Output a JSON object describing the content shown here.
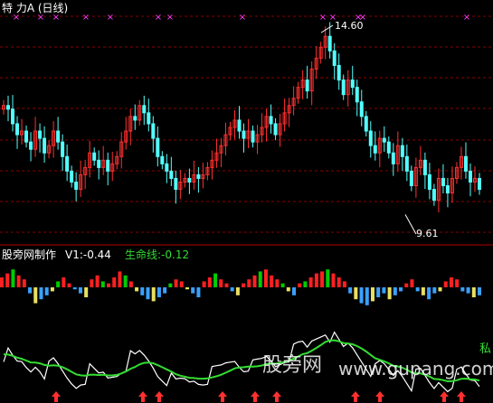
{
  "header": {
    "title": "特  力A (日线)"
  },
  "price_annotations": {
    "high_label": "14.60",
    "low_label": "9.61"
  },
  "indicator": {
    "name": "股旁网制作",
    "v1_label": "V1:-0.44",
    "life_label": "生命线:-0.12"
  },
  "watermark": {
    "site_cn": "股旁网",
    "site_en": "www.gupang.com",
    "corner_char": "私"
  },
  "colors": {
    "background": "#000000",
    "up_candle": "#ff3030",
    "down_candle": "#54ffff",
    "grid": "#8a0000",
    "marker": "#ff40ff",
    "hist_red": "#ff2020",
    "hist_green": "#00cc00",
    "hist_blue": "#3aa0ff",
    "hist_yellow": "#e8e060",
    "line_green": "#33dd33",
    "line_white": "#ffffff",
    "arrow": "#ff3030"
  },
  "chart_data": [
    {
      "type": "candlestick",
      "title": "特  力A (日线)",
      "ylim": [
        9.0,
        15.0
      ],
      "high": 14.6,
      "low": 9.61,
      "close_series": [
        12.6,
        12.5,
        12.1,
        11.8,
        11.9,
        11.6,
        11.4,
        11.9,
        11.7,
        11.3,
        11.5,
        11.9,
        11.6,
        11.2,
        10.8,
        10.5,
        10.3,
        10.7,
        10.9,
        11.3,
        11.1,
        10.9,
        11.1,
        10.8,
        11.0,
        11.2,
        11.6,
        11.9,
        12.3,
        12.2,
        12.6,
        12.4,
        12.1,
        11.7,
        11.2,
        11.0,
        10.8,
        10.6,
        10.3,
        10.5,
        10.6,
        10.5,
        10.7,
        10.6,
        10.7,
        10.9,
        11.1,
        11.3,
        11.5,
        11.8,
        12.0,
        12.2,
        11.9,
        11.7,
        11.9,
        11.6,
        11.8,
        12.0,
        12.3,
        12.1,
        11.8,
        12.1,
        12.4,
        12.6,
        12.8,
        13.1,
        13.3,
        13.0,
        13.6,
        13.9,
        14.2,
        14.5,
        14.1,
        13.7,
        13.3,
        12.9,
        13.3,
        13.1,
        12.7,
        12.3,
        11.9,
        11.5,
        11.3,
        11.7,
        11.6,
        11.3,
        11.0,
        11.5,
        11.2,
        10.8,
        10.4,
        10.9,
        11.1,
        10.7,
        10.3,
        10.0,
        10.6,
        10.4,
        10.2,
        10.6,
        10.9,
        11.2,
        10.8,
        10.5,
        10.6,
        10.3
      ],
      "markers_top": 13,
      "series": [
        {
          "name": "V1",
          "values": [
            -0.44
          ]
        },
        {
          "name": "生命线",
          "values": [
            -0.12
          ]
        }
      ],
      "histogram": [
        0.5,
        0.7,
        0.9,
        0.6,
        0.4,
        -0.3,
        -0.8,
        -0.6,
        -0.4,
        -0.2,
        0.3,
        0.5,
        0.2,
        -0.1,
        -0.3,
        -0.5,
        0.4,
        0.6,
        0.3,
        0.2,
        0.5,
        0.8,
        0.6,
        0.3,
        -0.2,
        -0.4,
        -0.6,
        -0.7,
        -0.5,
        -0.3,
        0.2,
        0.4,
        0.3,
        -0.1,
        -0.3,
        -0.5,
        0.3,
        0.5,
        0.7,
        0.4,
        0.2,
        -0.2,
        -0.4,
        0.2,
        0.4,
        0.6,
        0.8,
        0.9,
        0.6,
        0.4,
        0.2,
        -0.2,
        -0.4,
        0.2,
        0.3,
        0.5,
        0.7,
        0.8,
        0.9,
        0.7,
        0.5,
        0.3,
        -0.3,
        -0.6,
        -0.8,
        -0.9,
        -0.7,
        -0.5,
        -0.3,
        -0.6,
        -0.4,
        -0.2,
        0.2,
        0.4,
        -0.2,
        -0.4,
        -0.6,
        -0.3,
        -0.2,
        0.3,
        0.5,
        0.4,
        -0.2,
        -0.3,
        -0.5,
        -0.4
      ],
      "buy_arrows": 10
    }
  ]
}
